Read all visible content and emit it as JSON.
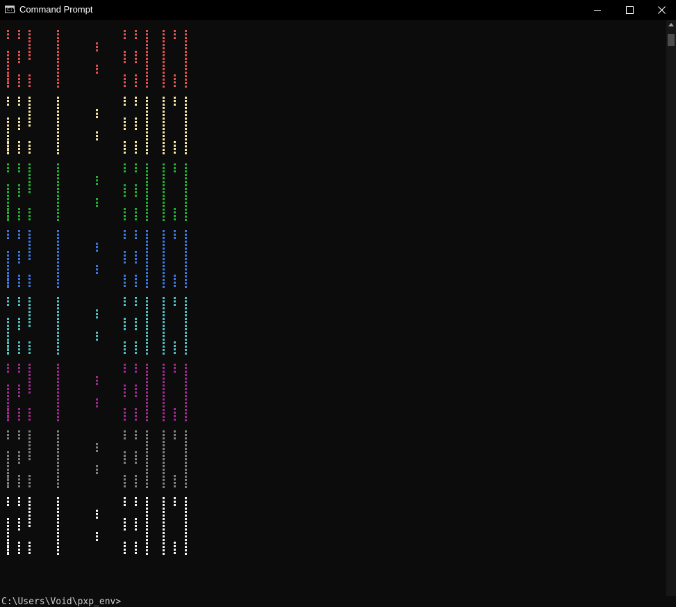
{
  "window": {
    "title": "Command Prompt",
    "icon": "cmd-icon",
    "controls": [
      "minimize-icon",
      "maximize-icon",
      "close-icon"
    ]
  },
  "console": {
    "art_rows": [
      {
        "color": "#e05050"
      },
      {
        "color": "#f4e4a0"
      },
      {
        "color": "#20b030"
      },
      {
        "color": "#3a78e0"
      },
      {
        "color": "#50c0c0"
      },
      {
        "color": "#a02890"
      },
      {
        "color": "#808080"
      },
      {
        "color": "#f2f2f2"
      }
    ],
    "prompt": "C:\\Users\\Void\\pxp_env>"
  }
}
